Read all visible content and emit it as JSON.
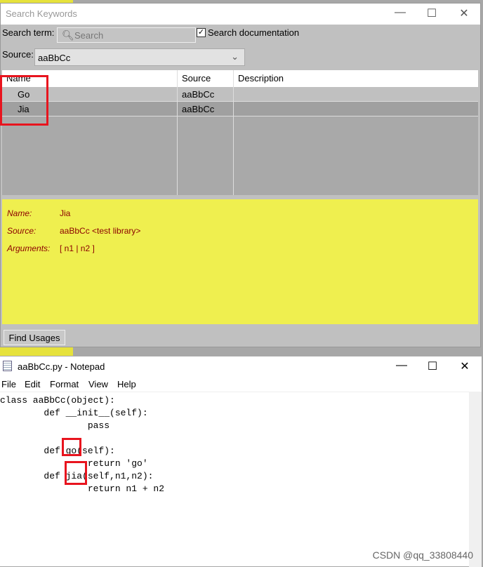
{
  "search_window": {
    "title": "Search Keywords",
    "search_term_label": "Search term:",
    "search_placeholder": "Search",
    "search_doc_label": "Search documentation",
    "search_doc_checked": true,
    "source_label": "Source:",
    "source_value": "aaBbCc",
    "columns": [
      "Name",
      "Source",
      "Description"
    ],
    "rows": [
      {
        "name": "Go",
        "source": "aaBbCc",
        "description": ""
      },
      {
        "name": "Jia",
        "source": "aaBbCc",
        "description": ""
      }
    ],
    "details": {
      "name_label": "Name:",
      "name": "Jia",
      "source_label": "Source:",
      "source": "aaBbCc <test library>",
      "args_label": "Arguments:",
      "args": "[ n1 | n2 ]"
    },
    "find_usages": "Find Usages"
  },
  "notepad": {
    "title": "aaBbCc.py - Notepad",
    "menu": [
      "File",
      "Edit",
      "Format",
      "View",
      "Help"
    ],
    "code": "class aaBbCc(object):\n        def __init__(self):\n                pass\n\n        def go(self):\n                return 'go'\n        def jia(self,n1,n2):\n                return n1 + n2"
  },
  "watermark": "CSDN @qq_33808440"
}
